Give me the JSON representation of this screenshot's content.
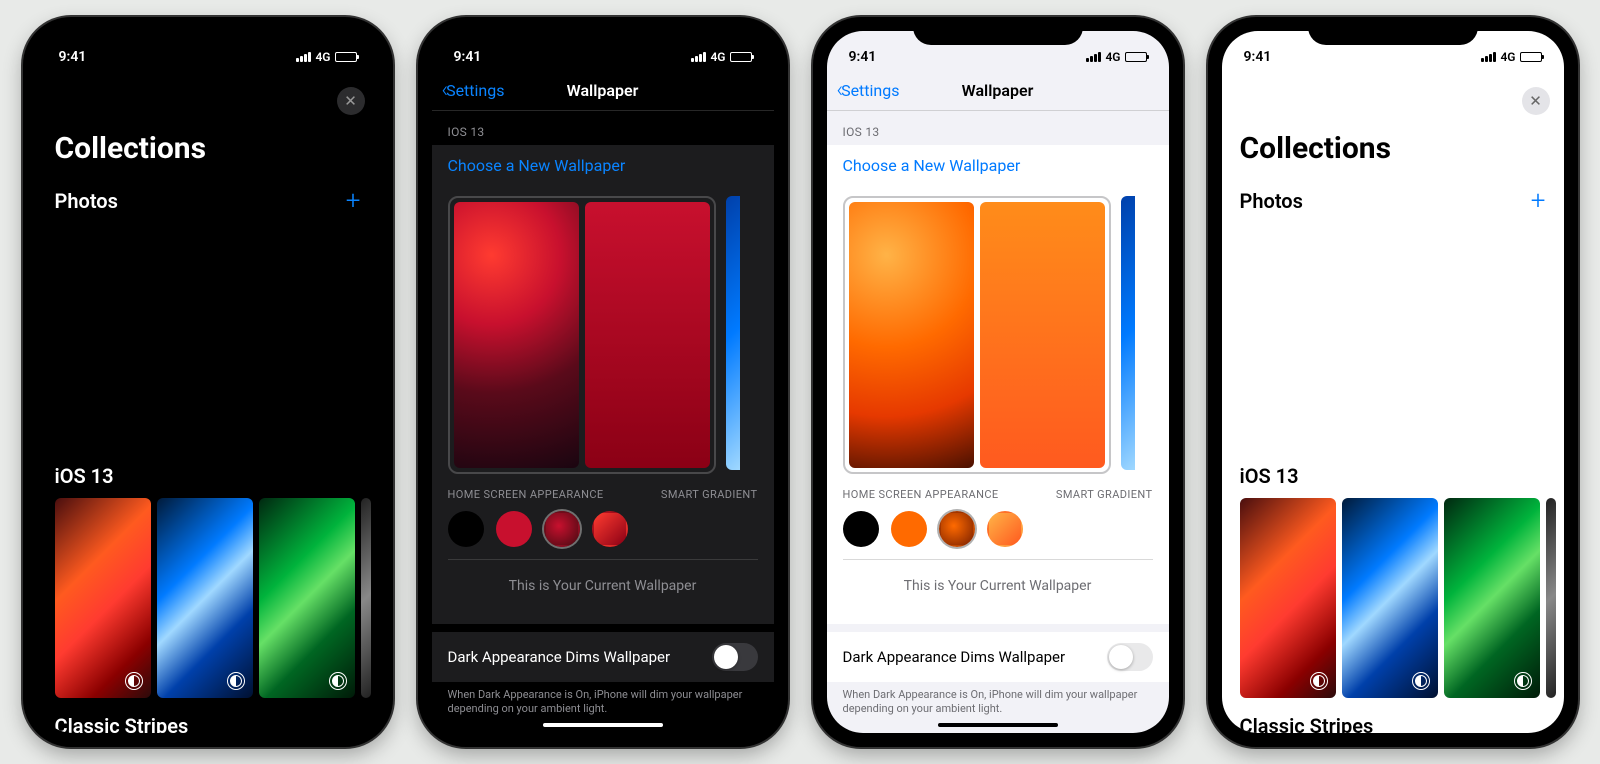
{
  "status": {
    "time": "9:41",
    "network": "4G"
  },
  "collections": {
    "title": "Collections",
    "photosLabel": "Photos",
    "ios13Label": "iOS 13",
    "classicLabel": "Classic Stripes"
  },
  "wallpaper": {
    "backLabel": "Settings",
    "title": "Wallpaper",
    "sectionLabel": "IOS 13",
    "chooseLabel": "Choose a New Wallpaper",
    "homeAppearance": "HOME SCREEN APPEARANCE",
    "smartGradient": "SMART GRADIENT",
    "currentLabel": "This is Your Current Wallpaper",
    "toggleLabel": "Dark Appearance Dims Wallpaper",
    "footer": "When Dark Appearance is On, iPhone will dim your wallpaper depending on your ambient light."
  },
  "stripes": [
    "#5ec95e",
    "#f5c518",
    "#ff9500",
    "#ff3b30"
  ]
}
